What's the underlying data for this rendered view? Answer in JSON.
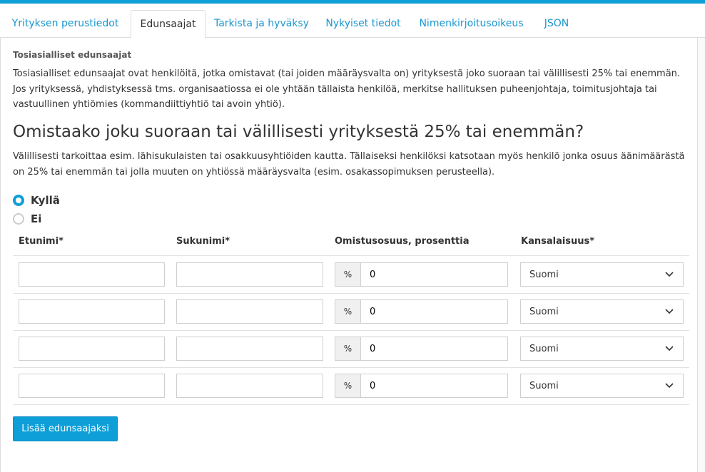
{
  "tabs": [
    {
      "label": "Yrityksen perustiedot"
    },
    {
      "label": "Edunsaajat"
    },
    {
      "label": "Tarkista ja hyväksy"
    },
    {
      "label": "Nykyiset tiedot"
    },
    {
      "label": "Nimenkirjoitusoikeus"
    },
    {
      "label": "JSON"
    }
  ],
  "active_tab": "Edunsaajat",
  "section": {
    "label": "Tosiasialliset edunsaajat",
    "description": "Tosiasialliset edunsaajat ovat henkilöitä, jotka omistavat (tai joiden määräysvalta on) yrityksestä joko suoraan tai välillisesti 25% tai enemmän. Jos yrityksessä, yhdistyksessä tms. organisaatiossa ei ole yhtään tällaista henkilöä, merkitse hallituksen puheenjohtaja, toimitusjohtaja tai vastuullinen yhtiömies (kommandiittiyhtiö tai avoin yhtiö)."
  },
  "question": {
    "title": "Omistaako joku suoraan tai välillisesti yrityksestä 25% tai enemmän?",
    "subtitle": "Välillisesti tarkoittaa esim. lähisukulaisten tai osakkuusyhtiöiden kautta. Tällaiseksi henkilöksi katsotaan myös henkilö jonka osuus äänimäärästä on 25% tai enemmän tai jolla muuten on yhtiössä määräysvalta (esim. osakassopimuksen perusteella).",
    "options": [
      {
        "label": "Kyllä",
        "checked": true
      },
      {
        "label": "Ei",
        "checked": false
      }
    ]
  },
  "table": {
    "headers": {
      "first_name": "Etunimi*",
      "last_name": "Sukunimi*",
      "ownership": "Omistusosuus, prosenttia",
      "citizenship": "Kansalaisuus*"
    },
    "percent_symbol": "%",
    "rows": [
      {
        "first_name": "",
        "last_name": "",
        "ownership": "0",
        "citizenship": "Suomi"
      },
      {
        "first_name": "",
        "last_name": "",
        "ownership": "0",
        "citizenship": "Suomi"
      },
      {
        "first_name": "",
        "last_name": "",
        "ownership": "0",
        "citizenship": "Suomi"
      },
      {
        "first_name": "",
        "last_name": "",
        "ownership": "0",
        "citizenship": "Suomi"
      }
    ]
  },
  "add_button_label": "Lisää edunsaajaksi",
  "colors": {
    "accent": "#0f9fd8",
    "link": "#1a97cf",
    "border": "#dddddd"
  }
}
